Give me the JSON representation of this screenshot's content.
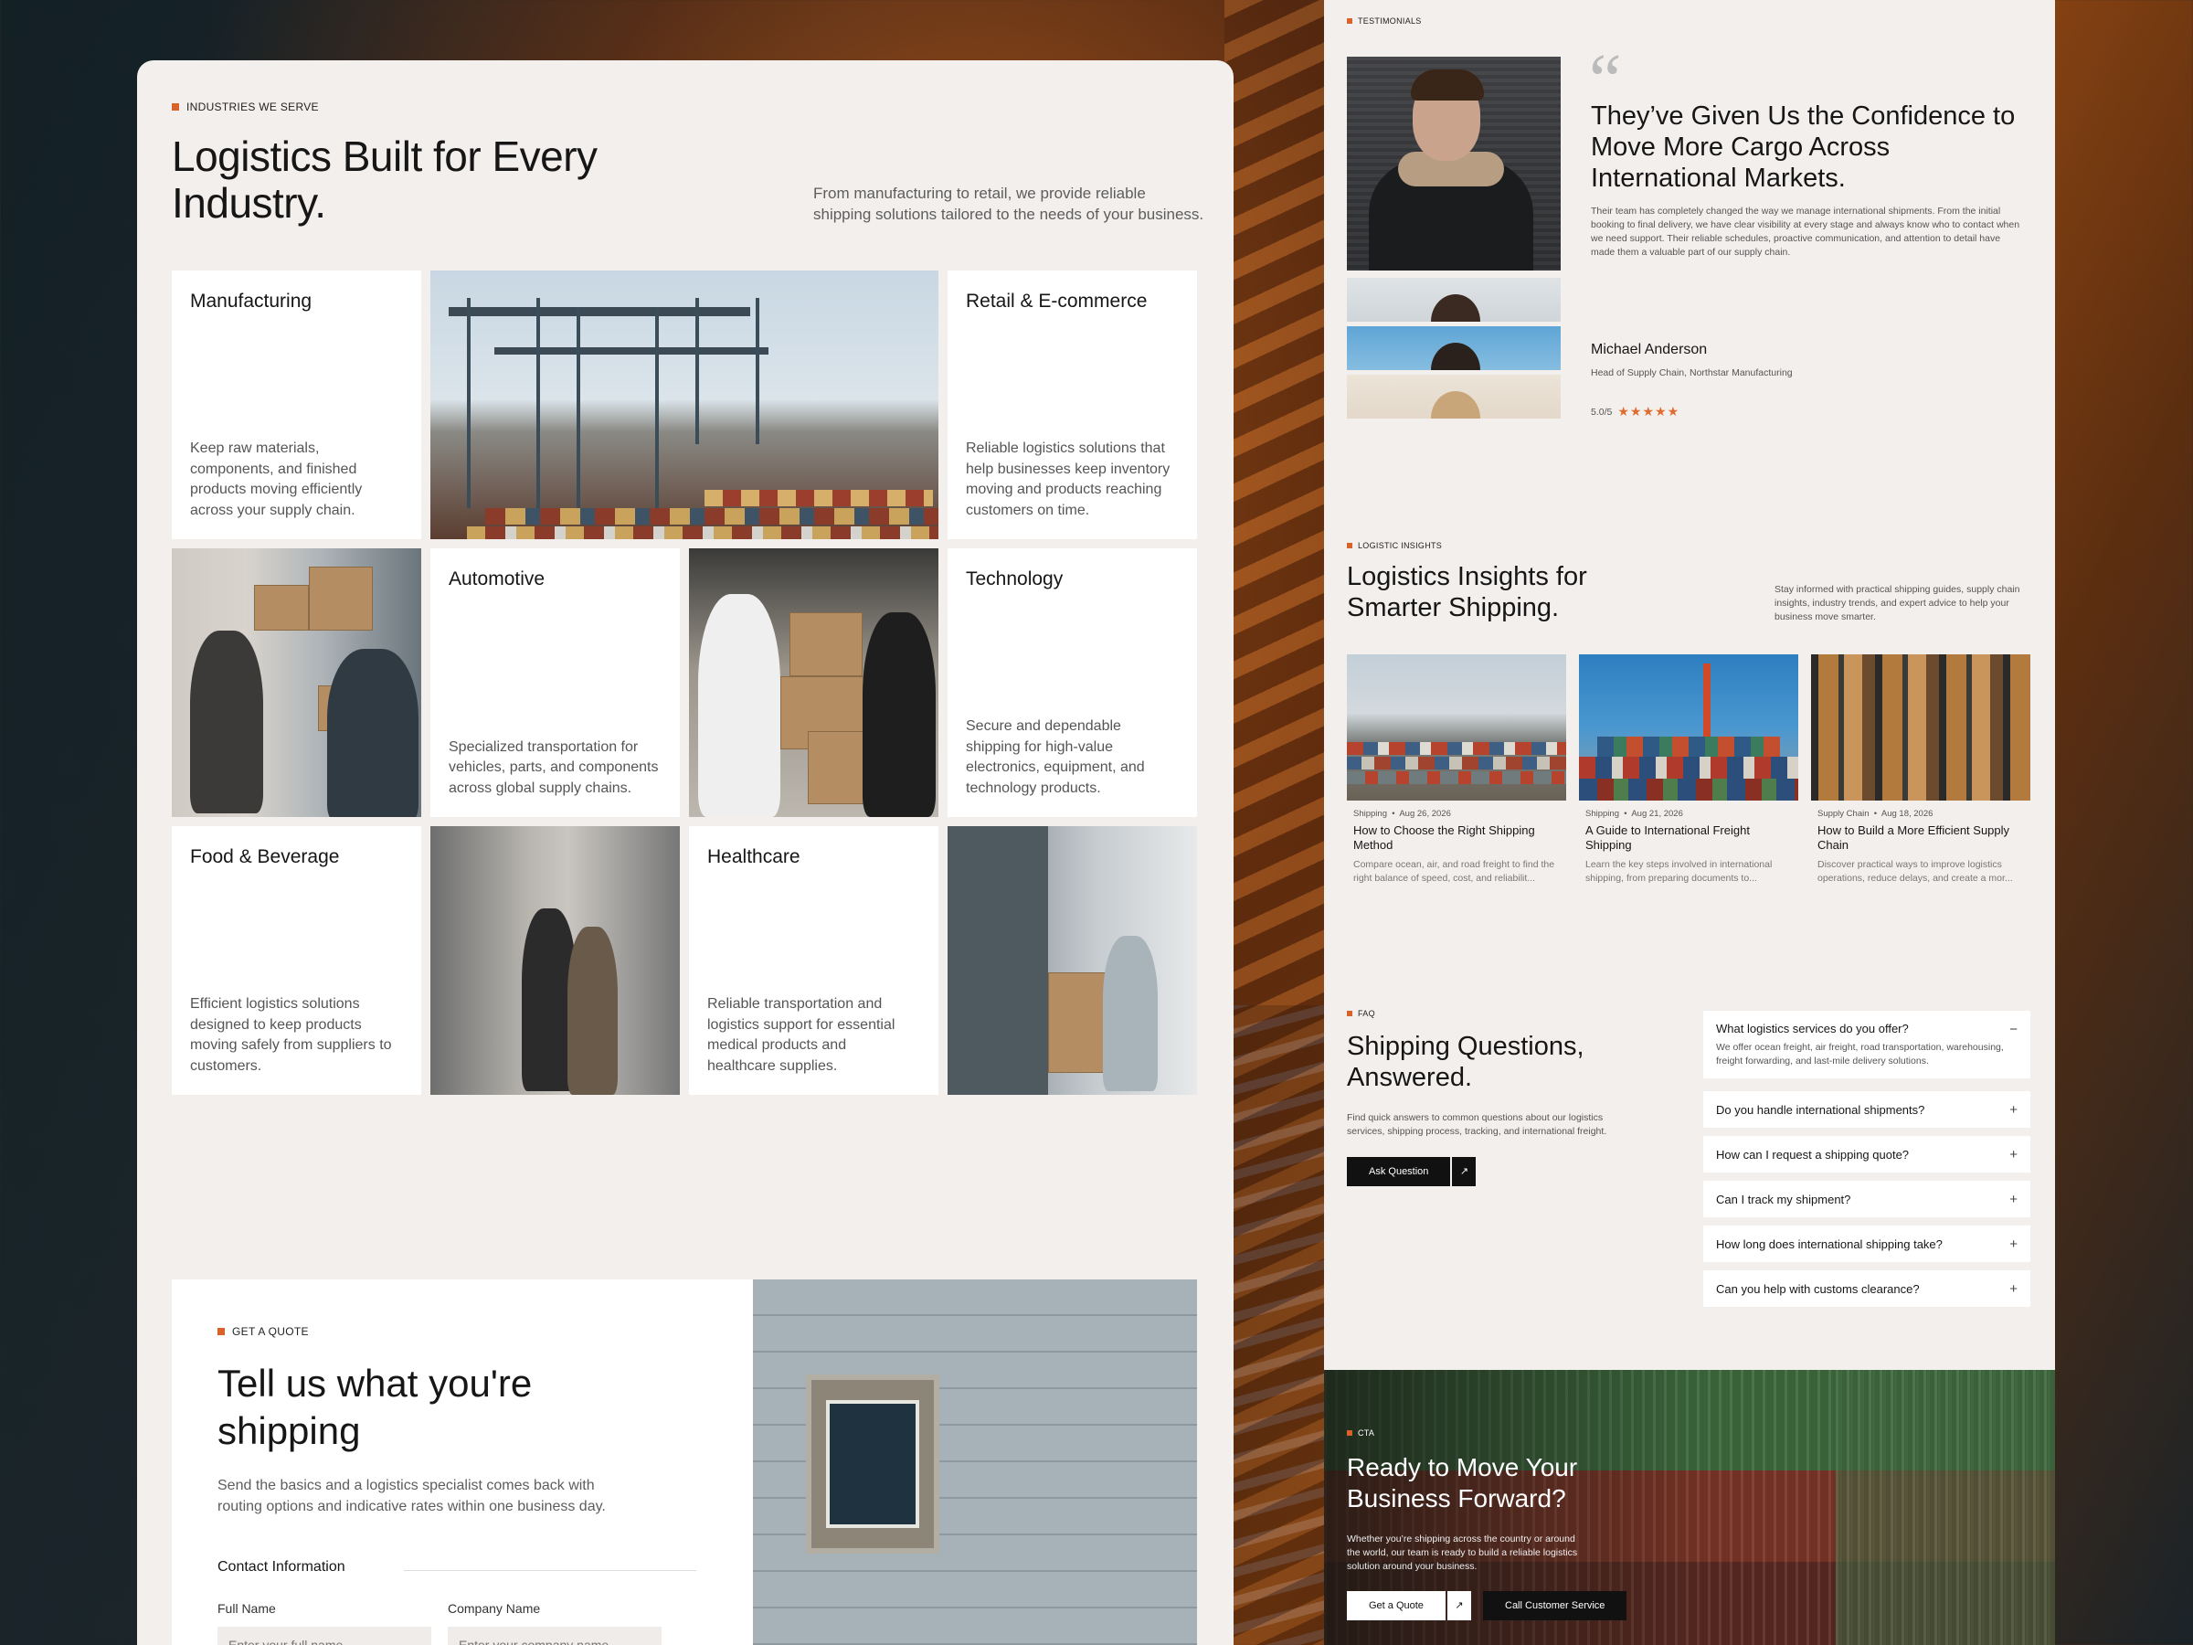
{
  "industries": {
    "tag": "Industries We Serve",
    "title": "Logistics Built for Every Industry.",
    "intro": "From manufacturing to retail, we provide reliable shipping solutions tailored to the needs of your business.",
    "cards": [
      {
        "title": "Manufacturing",
        "text": "Keep raw materials, components, and finished products moving efficiently across your supply chain."
      },
      {
        "title": "Retail & E-commerce",
        "text": "Reliable logistics solutions that help businesses keep inventory moving and products reaching customers on time."
      },
      {
        "title": "Automotive",
        "text": "Specialized transportation for vehicles, parts, and components across global supply chains."
      },
      {
        "title": "Technology",
        "text": "Secure and dependable shipping for high-value electronics, equipment, and technology products."
      },
      {
        "title": "Food & Beverage",
        "text": "Efficient logistics solutions designed to keep products moving safely from suppliers to customers."
      },
      {
        "title": "Healthcare",
        "text": "Reliable transportation and logistics support for essential medical products and healthcare supplies."
      }
    ]
  },
  "quote": {
    "tag": "Get a Quote",
    "title": "Tell us what you're shipping",
    "text": "Send the basics and a logistics specialist comes back with routing options and indicative rates within one business day.",
    "contact_heading": "Contact Information",
    "full_name_label": "Full Name",
    "full_name_placeholder": "Enter your full name",
    "company_label": "Company Name",
    "company_placeholder": "Enter your company name"
  },
  "testimonial": {
    "tag": "Testimonials",
    "headline": "They’ve Given Us the Confidence to Move More Cargo Across International Markets.",
    "body": "Their team has completely changed the way we manage international shipments. From the initial booking to final delivery, we have clear visibility at every stage and always know who to contact when we need support. Their reliable schedules, proactive communication, and attention to detail have made them a valuable part of our supply chain.",
    "name": "Michael Anderson",
    "role": "Head of Supply Chain, Northstar Manufacturing",
    "rating_text": "5.0/5",
    "rating": 5,
    "stars": "★★★★★"
  },
  "insights": {
    "tag": "Logistic Insights",
    "title": "Logistics Insights for Smarter Shipping.",
    "intro": "Stay informed with practical shipping guides, supply chain insights, industry trends, and expert advice to help your business move smarter.",
    "posts": [
      {
        "category": "Shipping",
        "date": "Aug 26, 2026",
        "title": "How to Choose the Right Shipping Method",
        "excerpt": "Compare ocean, air, and road freight to find the right balance of speed, cost, and reliabilit..."
      },
      {
        "category": "Shipping",
        "date": "Aug 21, 2026",
        "title": "A Guide to International Freight Shipping",
        "excerpt": "Learn the key steps involved in international shipping, from preparing documents to..."
      },
      {
        "category": "Supply Chain",
        "date": "Aug 18, 2026",
        "title": "How to Build a More Efficient Supply Chain",
        "excerpt": "Discover practical ways to improve logistics operations, reduce delays, and create a mor..."
      }
    ]
  },
  "faq": {
    "tag": "FAQ",
    "title": "Shipping Questions, Answered.",
    "intro": "Find quick answers to common questions about our logistics services, shipping process, tracking, and international freight.",
    "ask_label": "Ask Question",
    "arrow": "↗",
    "open_symbol": "−",
    "closed_symbol": "+",
    "items": [
      {
        "q": "What logistics services do you offer?",
        "a": "We offer ocean freight, air freight, road transportation, warehousing, freight forwarding, and last-mile delivery solutions."
      },
      {
        "q": "Do you handle international shipments?"
      },
      {
        "q": "How can I request a shipping quote?"
      },
      {
        "q": "Can I track my shipment?"
      },
      {
        "q": "How long does international shipping take?"
      },
      {
        "q": "Can you help with customs clearance?"
      }
    ]
  },
  "cta": {
    "tag": "CTA",
    "title": "Ready to Move Your Business Forward?",
    "text": "Whether you’re shipping across the country or around the world, our team is ready to build a reliable logistics solution around your business.",
    "quote_label": "Get a Quote",
    "arrow": "↗",
    "service_label": "Call Customer Service"
  },
  "colors": {
    "accent": "#d9622b",
    "panel": "#f3efed",
    "dark": "#111111"
  }
}
